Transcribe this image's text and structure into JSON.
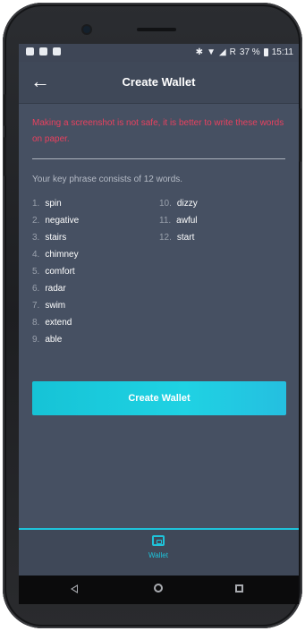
{
  "status_bar": {
    "battery": "37 %",
    "time": "15:11",
    "left_icons": [
      "notification-icon",
      "location-icon",
      "image-icon"
    ],
    "right_icons": [
      "bluetooth-icon",
      "wifi-icon",
      "signal-icon"
    ],
    "network": "R"
  },
  "header": {
    "back_icon": "back-arrow-icon",
    "title": "Create Wallet"
  },
  "warning": "Making a screenshot is not safe, it is better to write these words on paper.",
  "info": "Your key phrase consists of 12 words.",
  "words": [
    {
      "num": "1.",
      "word": "spin"
    },
    {
      "num": "2.",
      "word": "negative"
    },
    {
      "num": "3.",
      "word": "stairs"
    },
    {
      "num": "4.",
      "word": "chimney"
    },
    {
      "num": "5.",
      "word": "comfort"
    },
    {
      "num": "6.",
      "word": "radar"
    },
    {
      "num": "7.",
      "word": "swim"
    },
    {
      "num": "8.",
      "word": "extend"
    },
    {
      "num": "9.",
      "word": "able"
    },
    {
      "num": "10.",
      "word": "dizzy"
    },
    {
      "num": "11.",
      "word": "awful"
    },
    {
      "num": "12.",
      "word": "start"
    }
  ],
  "button": {
    "label": "Create Wallet"
  },
  "tabbar": {
    "icon": "wallet-icon",
    "label": "Wallet"
  },
  "nav": {
    "back": "nav-back-icon",
    "home": "nav-home-icon",
    "recents": "nav-recents-icon"
  },
  "colors": {
    "background": "#465062",
    "warning": "#e8415f",
    "accent": "#1ec3da"
  }
}
